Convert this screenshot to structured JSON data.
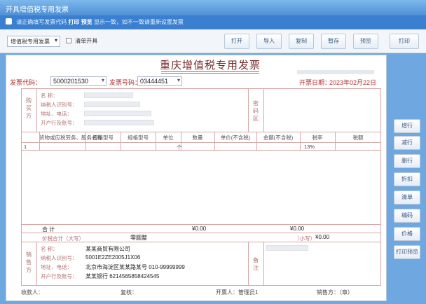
{
  "window": {
    "title": "开具增值税专用发票"
  },
  "notice": {
    "text_a": "请正确填写发票代码",
    "highlight_1": "打印",
    "highlight_2": "预览",
    "text_b": "显示一致，如不一致请重新设置发票",
    "accent": "#3b7fd0"
  },
  "toolbar": {
    "mode_select": "增值税专用发票",
    "checkbox_label": "清单开具",
    "buttons": [
      "打开",
      "导入",
      "复制",
      "暂存",
      "预览",
      "打印"
    ]
  },
  "invoice": {
    "title": "重庆增值税专用发票",
    "code_label": "发票代码：",
    "code_value": "5000201530",
    "number_label": "发票号码：",
    "number_value": "03444451",
    "date_label": "开票日期：",
    "date_value": "2023年02月22日",
    "buyer_section": "购买方",
    "password_section": "密码区",
    "seller_section": "销售方",
    "remarks_section": "备注",
    "buyer_rows": [
      "名 称：",
      "纳税人识别号：",
      "地址、电话：",
      "开户行及账号："
    ],
    "seller_rows": [
      "名 称：",
      "纳税人识别号：",
      "地址、电话：",
      "开户行及账号："
    ],
    "seller_values": {
      "name": "某某商贸有限公司",
      "tax_id": "5001E2ZE2005J1X06",
      "address": "北京市海淀区某某路某号 010-99999999",
      "bank": "某某银行 6214565858424545"
    },
    "columns": [
      "货物或应税劳务、服务名称",
      "规格型号",
      "规格型号",
      "单位",
      "数量",
      "单价(不含税)",
      "金额(不含税)",
      "税率",
      "税额"
    ],
    "item_row": {
      "index": "1",
      "unit_mark": "个",
      "tax_rate": "13%"
    },
    "totals_label": "合  计",
    "totals_amount": "¥0.00",
    "totals_tax": "¥0.00",
    "total_words_label": "价税合计（大写）",
    "total_words_value": "零圆整",
    "total_small_label": "（小写）",
    "total_small_value": "¥0.00",
    "signatures": {
      "payee_label": "收款人：",
      "reviewer_label": "复核：",
      "drawer_label": "开票人：",
      "drawer_value": "管理员1",
      "seller_label": "销售方：（章）"
    }
  },
  "side_buttons": [
    "增行",
    "减行",
    "删行",
    "折扣",
    "清单",
    "编码",
    "价格",
    "打印预览"
  ]
}
